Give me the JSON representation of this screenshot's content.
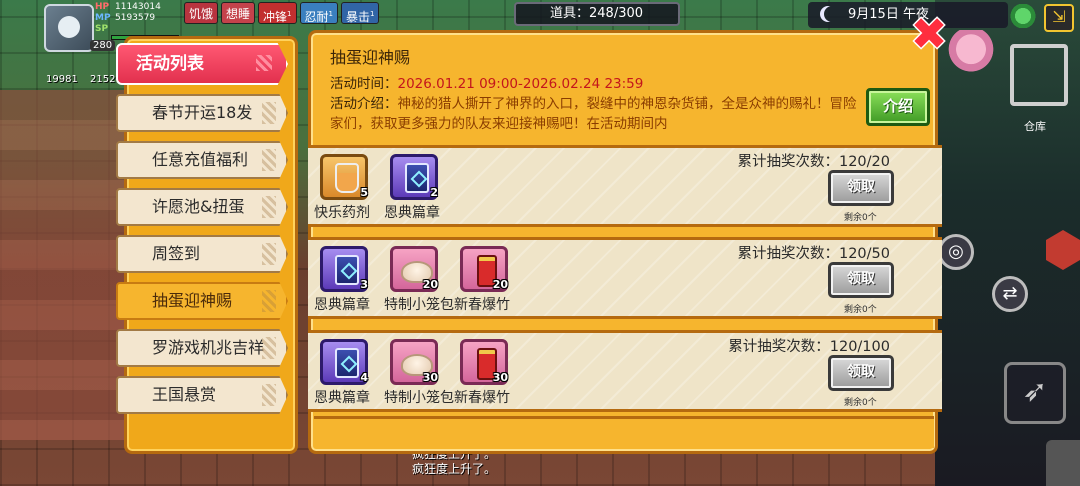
{
  "hud": {
    "level": "280",
    "hp_label": "HP",
    "hp_value": "11143014",
    "mp_label": "MP",
    "mp_value": "5193579",
    "sp_label": "SP",
    "sp_value": "",
    "currency_a": "19981",
    "currency_b": "2152",
    "buffs": [
      {
        "label": "饥饿",
        "color": "#b8343f"
      },
      {
        "label": "想睡",
        "color": "#c4424b"
      },
      {
        "label": "冲锋",
        "sup": "1",
        "color": "#c22f2f"
      },
      {
        "label": "忍耐",
        "sup": "1",
        "color": "#3a7fbf"
      },
      {
        "label": "暴击",
        "sup": "1",
        "color": "#3165a6"
      }
    ],
    "items_label": "道具：248/300",
    "date_time": "9月15日 午夜",
    "warehouse_label": "仓库"
  },
  "sidebar": {
    "header": "活动列表",
    "items": [
      {
        "label": "春节开运18发"
      },
      {
        "label": "任意充值福利"
      },
      {
        "label": "许愿池&扭蛋"
      },
      {
        "label": "周签到"
      },
      {
        "label": "抽蛋迎神赐",
        "active": true
      },
      {
        "label": "罗游戏机兆吉祥"
      },
      {
        "label": "王国悬赏"
      }
    ]
  },
  "main": {
    "title": "抽蛋迎神赐",
    "time_label": "活动时间：",
    "time_value": "2026.01.21 09:00-2026.02.24 23:59",
    "desc_label": "活动介绍：",
    "desc_value": "神秘的猎人撕开了神界的入口，裂缝中的神恩杂货铺，全是众神的赐礼！冒险家们，获取更多强力的队友来迎接神赐吧！在活动期间内",
    "intro_button": "介绍",
    "claim_label": "领取",
    "remain_label": "剩余0个",
    "rows": [
      {
        "progress": "累计抽奖次数：120/20",
        "rewards": [
          {
            "name": "快乐药剂",
            "count": "5",
            "icon": "potion-icon",
            "rarity": "gold"
          },
          {
            "name": "恩典篇章",
            "count": "2",
            "icon": "card-icon",
            "rarity": "purple"
          }
        ]
      },
      {
        "progress": "累计抽奖次数：120/50",
        "rewards": [
          {
            "name": "恩典篇章",
            "count": "3",
            "icon": "card-icon",
            "rarity": "purple"
          },
          {
            "name": "特制小笼包",
            "count": "20",
            "icon": "bun-icon",
            "rarity": "pink"
          },
          {
            "name": "新春爆竹",
            "count": "20",
            "icon": "firecracker-icon",
            "rarity": "pink"
          }
        ]
      },
      {
        "progress": "累计抽奖次数：120/100",
        "rewards": [
          {
            "name": "恩典篇章",
            "count": "4",
            "icon": "card-icon",
            "rarity": "purple"
          },
          {
            "name": "特制小笼包",
            "count": "30",
            "icon": "bun-icon",
            "rarity": "pink"
          },
          {
            "name": "新春爆竹",
            "count": "30",
            "icon": "firecracker-icon",
            "rarity": "pink"
          }
        ]
      }
    ]
  },
  "chat_log": [
    "疯狂度上升了。",
    "疯狂度上升了。"
  ],
  "colors": {
    "accent": "#f6b52e",
    "active_tab": "#ff5872",
    "time_red": "#c4161c"
  }
}
